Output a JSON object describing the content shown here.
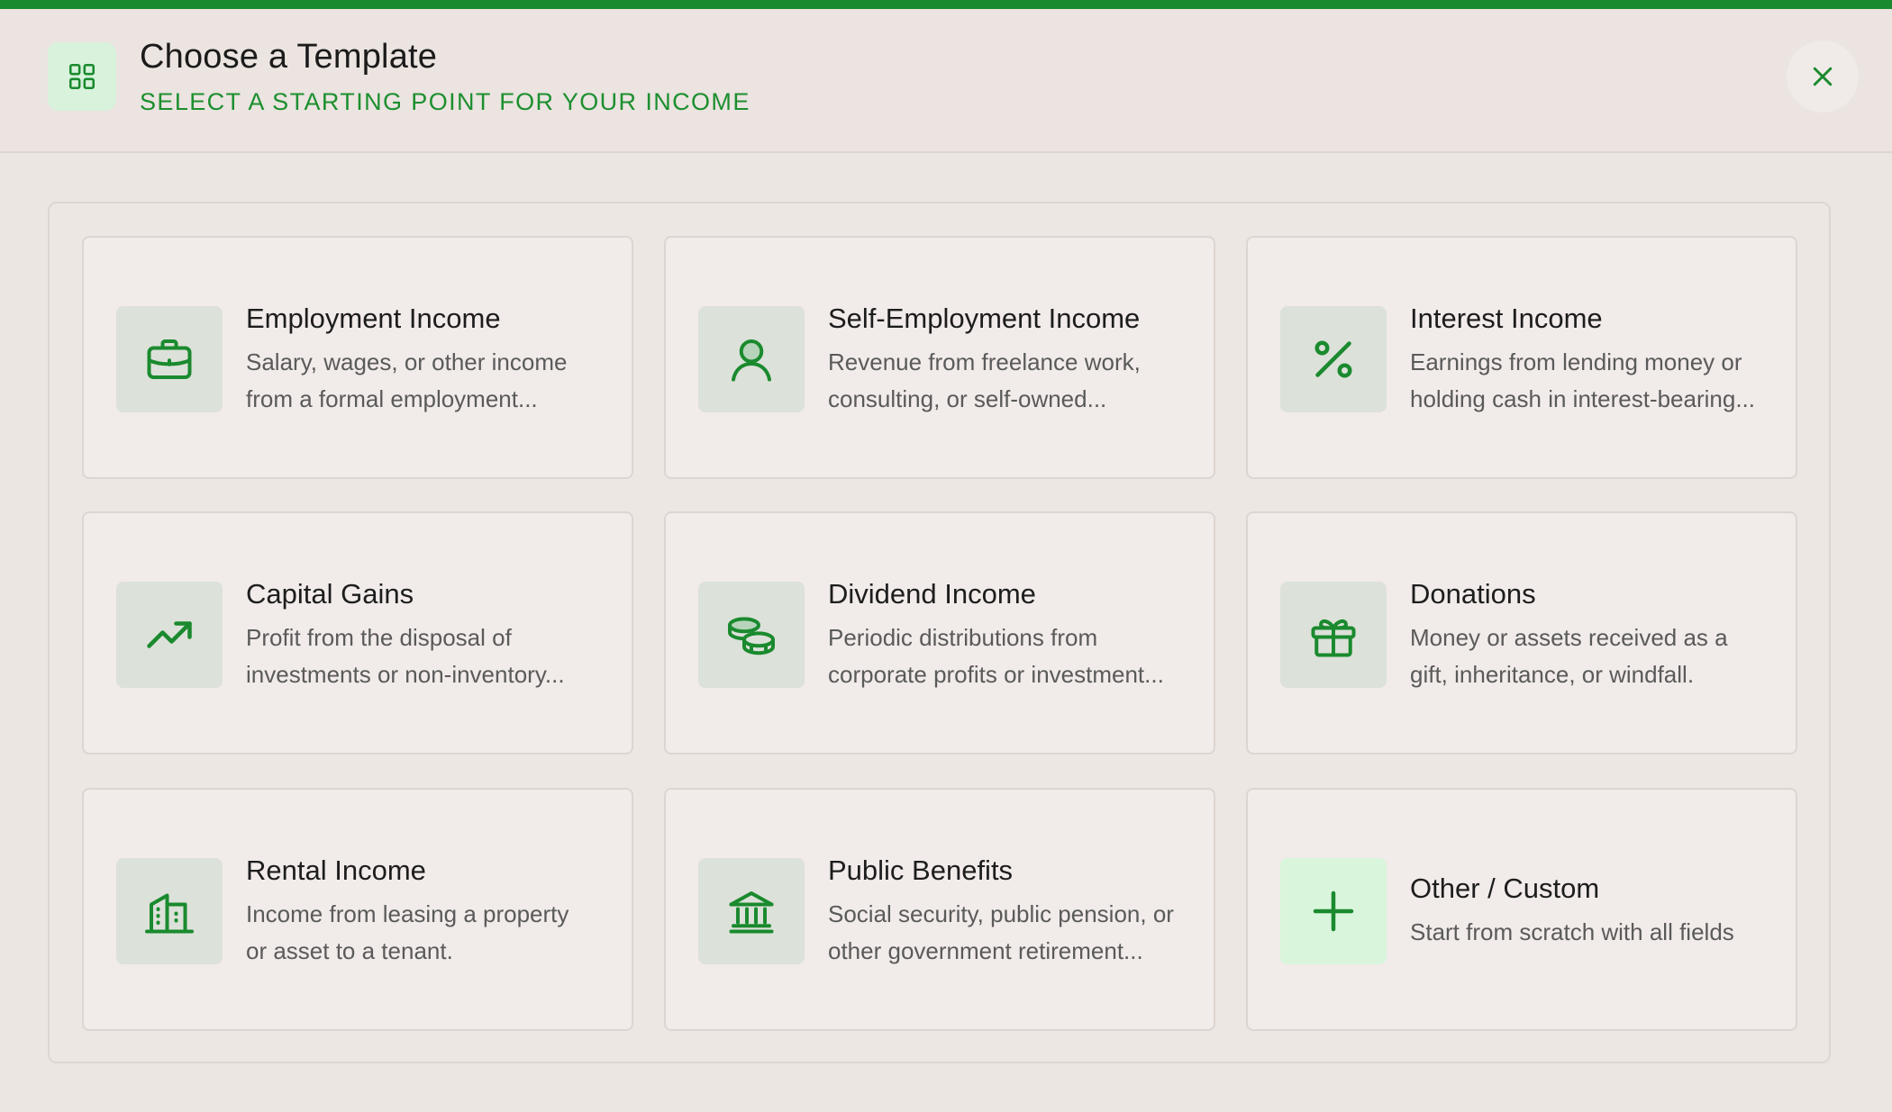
{
  "header": {
    "title": "Choose a Template",
    "subtitle": "SELECT A STARTING POINT FOR YOUR INCOME",
    "icon": "grid-icon",
    "close_icon": "close-icon"
  },
  "colors": {
    "accent": "#1a8a2e",
    "icon_bg": "#dce1d9",
    "highlight_bg": "#d9f5dc"
  },
  "templates": [
    {
      "title": "Employment Income",
      "line1": "Salary, wages, or other income",
      "line2": "from a formal employment...",
      "icon": "briefcase-icon"
    },
    {
      "title": "Self-Employment Income",
      "line1": "Revenue from freelance work,",
      "line2": "consulting, or self-owned...",
      "icon": "person-icon"
    },
    {
      "title": "Interest Income",
      "line1": "Earnings from lending money or",
      "line2": "holding cash in interest-bearing...",
      "icon": "percent-icon"
    },
    {
      "title": "Capital Gains",
      "line1": "Profit from the disposal of",
      "line2": "investments or non-inventory...",
      "icon": "trending-up-icon"
    },
    {
      "title": "Dividend Income",
      "line1": "Periodic distributions from",
      "line2": "corporate profits or investment...",
      "icon": "coins-icon"
    },
    {
      "title": "Donations",
      "line1": "Money or assets received as a",
      "line2": "gift, inheritance, or windfall.",
      "icon": "gift-icon"
    },
    {
      "title": "Rental Income",
      "line1": "Income from leasing a property",
      "line2": "or asset to a tenant.",
      "icon": "building-icon"
    },
    {
      "title": "Public Benefits",
      "line1": "Social security, public pension, or",
      "line2": "other government retirement...",
      "icon": "bank-icon"
    },
    {
      "title": "Other / Custom",
      "line1": "Start from scratch with all fields",
      "line2": "",
      "icon": "plus-icon"
    }
  ]
}
